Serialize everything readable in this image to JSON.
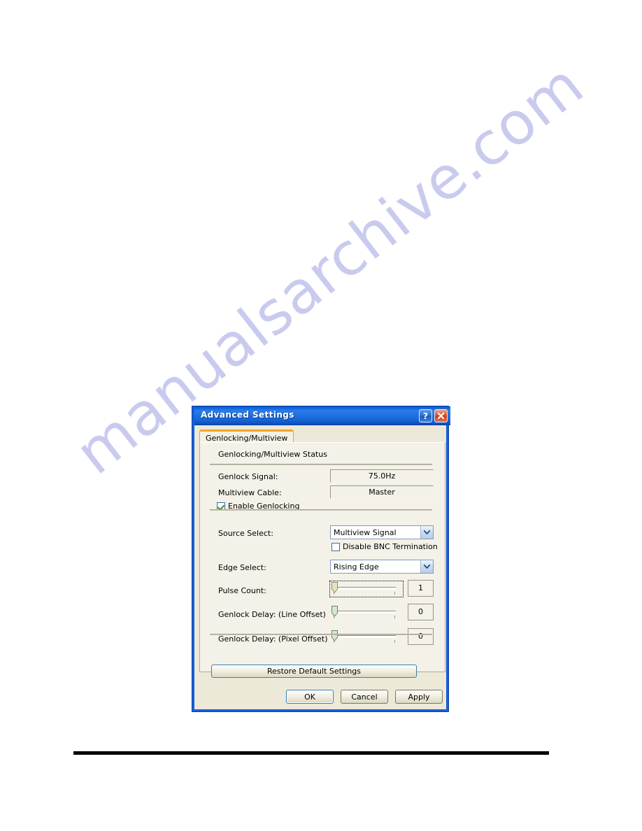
{
  "page": {
    "watermark_text": "manualsarchive.com"
  },
  "dialog": {
    "title": "Advanced Settings",
    "titlebar_buttons": [
      {
        "name": "help-button",
        "glyph": "?"
      },
      {
        "name": "close-button",
        "glyph": "X"
      }
    ],
    "tab": {
      "label": "Genlocking/Multiview"
    },
    "section_header": "Genlocking/Multiview Status",
    "status_fields": [
      {
        "label": "Genlock Signal:",
        "value": "75.0Hz"
      },
      {
        "label": "Multiview Cable:",
        "value": "Master"
      }
    ],
    "enable_genlocking": {
      "label": "Enable Genlocking",
      "checked": true
    },
    "source_select": {
      "label": "Source Select:",
      "value": "Multiview Signal"
    },
    "disable_bnc": {
      "label": "Disable BNC Termination",
      "checked": false
    },
    "edge_select": {
      "label": "Edge Select:",
      "value": "Rising Edge"
    },
    "sliders": [
      {
        "label": "Pulse Count:",
        "value": "1",
        "focused": true
      },
      {
        "label": "Genlock Delay: (Line Offset)",
        "value": "0",
        "focused": false
      },
      {
        "label": "Genlock Delay: (Pixel Offset)",
        "value": "0",
        "focused": false
      }
    ],
    "restore_button": "Restore Default Settings",
    "footer_buttons": {
      "ok": "OK",
      "cancel": "Cancel",
      "apply": "Apply"
    },
    "colors": {
      "titlebar_blue": "#1868da",
      "frame_blue": "#1860d8",
      "tab_accent_orange": "#f2a52c",
      "dialog_face": "#ece9d8",
      "tabpage_face": "#f4f1e8",
      "close_red": "#cf3d1c",
      "check_green": "#2f8a34",
      "watermark": "#c9cbee"
    }
  }
}
